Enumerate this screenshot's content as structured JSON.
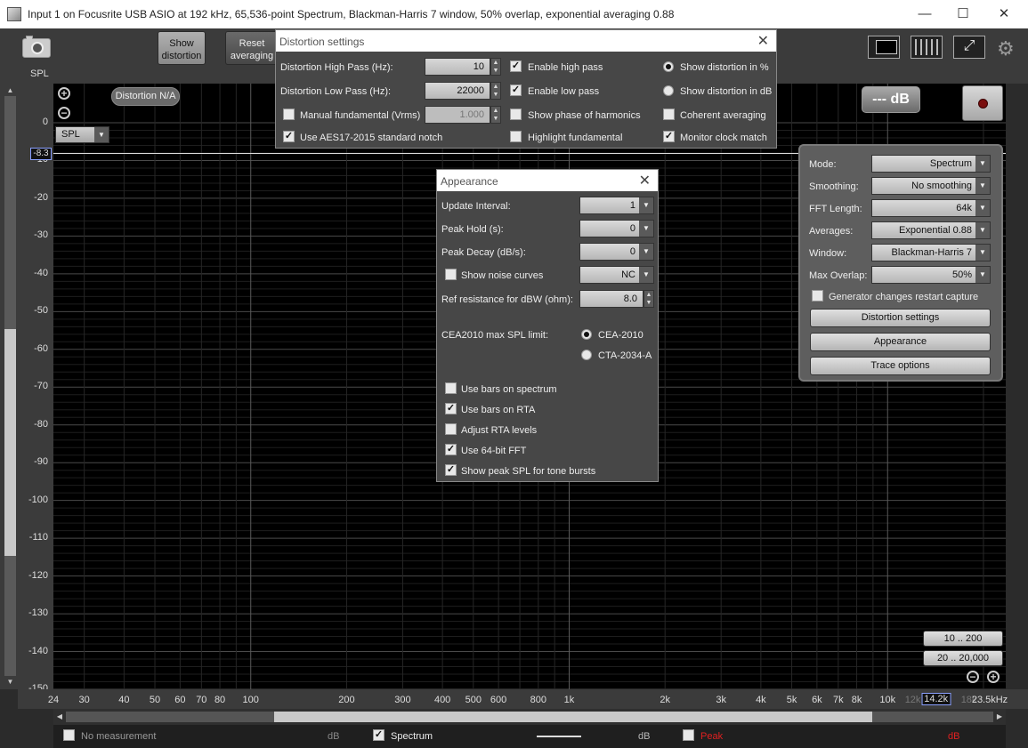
{
  "window": {
    "title": "Input 1 on Focusrite USB ASIO at 192 kHz, 65,536-point Spectrum, Blackman-Harris 7 window, 50% overlap, exponential averaging 0.88",
    "minimize": "—",
    "maximize": "☐",
    "close": "✕"
  },
  "toolbar": {
    "spl_label": "SPL",
    "show_distortion": "Show\ndistortion",
    "reset_averaging": "Reset\naveraging"
  },
  "graph": {
    "distortion_na": "Distortion N/A",
    "spl_select": "SPL",
    "cursor_value": "-8.3",
    "db_button": "--- dB",
    "y_ticks": [
      "0",
      "-10",
      "-20",
      "-30",
      "-40",
      "-50",
      "-60",
      "-70",
      "-80",
      "-90",
      "-100",
      "-110",
      "-120",
      "-130",
      "-140",
      "-150"
    ],
    "x_ticks": [
      {
        "label": "24",
        "f": 24
      },
      {
        "label": "30",
        "f": 30
      },
      {
        "label": "40",
        "f": 40
      },
      {
        "label": "50",
        "f": 50
      },
      {
        "label": "60",
        "f": 60
      },
      {
        "label": "70",
        "f": 70
      },
      {
        "label": "80",
        "f": 80
      },
      {
        "label": "100",
        "f": 100
      },
      {
        "label": "200",
        "f": 200
      },
      {
        "label": "300",
        "f": 300
      },
      {
        "label": "400",
        "f": 400
      },
      {
        "label": "500",
        "f": 500
      },
      {
        "label": "600",
        "f": 600
      },
      {
        "label": "800",
        "f": 800
      },
      {
        "label": "1k",
        "f": 1000
      },
      {
        "label": "2k",
        "f": 2000
      },
      {
        "label": "3k",
        "f": 3000
      },
      {
        "label": "4k",
        "f": 4000
      },
      {
        "label": "5k",
        "f": 5000
      },
      {
        "label": "6k",
        "f": 6000
      },
      {
        "label": "7k",
        "f": 7000
      },
      {
        "label": "8k",
        "f": 8000
      },
      {
        "label": "10k",
        "f": 10000
      },
      {
        "label": "12k",
        "f": 12000
      },
      {
        "label": "14.2k",
        "f": 14200
      },
      {
        "label": "18k",
        "f": 18000
      },
      {
        "label": "23.5kHz",
        "f": 23500
      }
    ],
    "range_10_200": "10 .. 200",
    "range_20_20000": "20 .. 20,000"
  },
  "status": {
    "no_measurement": "No measurement",
    "db1": "dB",
    "spectrum": "Spectrum",
    "db2": "dB",
    "peak": "Peak",
    "db3": "dB"
  },
  "distortion_dialog": {
    "title": "Distortion settings",
    "high_pass_label": "Distortion High Pass (Hz):",
    "high_pass_value": "10",
    "low_pass_label": "Distortion Low Pass (Hz):",
    "low_pass_value": "22000",
    "manual_fundamental": "Manual fundamental (Vrms)",
    "manual_fundamental_value": "1.000",
    "aes17": "Use AES17-2015 standard notch",
    "enable_high_pass": "Enable high pass",
    "enable_low_pass": "Enable low pass",
    "show_phase": "Show phase of harmonics",
    "highlight_fundamental": "Highlight fundamental",
    "show_pct": "Show distortion in %",
    "show_db": "Show distortion in dB",
    "coherent": "Coherent averaging",
    "monitor_clock": "Monitor clock match"
  },
  "appearance_dialog": {
    "title": "Appearance",
    "update_interval_label": "Update Interval:",
    "update_interval_value": "1",
    "peak_hold_label": "Peak Hold (s):",
    "peak_hold_value": "0",
    "peak_decay_label": "Peak Decay (dB/s):",
    "peak_decay_value": "0",
    "show_noise_label": "Show noise curves",
    "noise_value": "NC",
    "ref_res_label": "Ref resistance for dBW (ohm):",
    "ref_res_value": "8.0",
    "cea_label": "CEA2010 max SPL limit:",
    "cea_2010": "CEA-2010",
    "cta_2034": "CTA-2034-A",
    "bars_spectrum": "Use bars on spectrum",
    "bars_rta": "Use bars on RTA",
    "adjust_rta": "Adjust RTA levels",
    "fft64": "Use 64-bit FFT",
    "peak_spl": "Show peak SPL for tone bursts"
  },
  "side_panel": {
    "mode_label": "Mode:",
    "mode_value": "Spectrum",
    "smoothing_label": "Smoothing:",
    "smoothing_value": "No  smoothing",
    "fft_label": "FFT Length:",
    "fft_value": "64k",
    "averages_label": "Averages:",
    "averages_value": "Exponential 0.88",
    "window_label": "Window:",
    "window_value": "Blackman-Harris 7",
    "overlap_label": "Max Overlap:",
    "overlap_value": "50%",
    "generator_restart": "Generator changes restart capture",
    "distortion_settings_btn": "Distortion settings",
    "appearance_btn": "Appearance",
    "trace_options_btn": "Trace options"
  }
}
